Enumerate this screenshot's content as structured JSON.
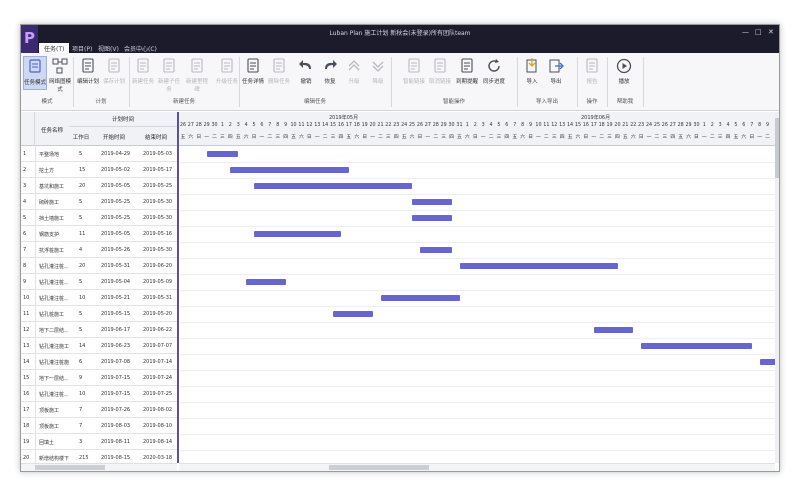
{
  "app": {
    "title": "Luban Plan 施工计划 新秋会(未登录)所有团队team",
    "logo": "P",
    "win_min": "—",
    "win_max": "□",
    "win_close": "✕"
  },
  "menu": [
    "任务(T)",
    "项目(P)",
    "视图(V)",
    "会员中心(C)"
  ],
  "ribbon": {
    "buttons": [
      {
        "label": "任务模式",
        "icon": "task-mode"
      },
      {
        "label": "网络图模式",
        "icon": "network"
      },
      {
        "label": "编辑计划",
        "icon": "edit-plan"
      },
      {
        "label": "保存计划",
        "icon": "save-plan"
      },
      {
        "label": "新建任务",
        "icon": "new-task"
      },
      {
        "label": "新建子任务",
        "icon": "new-sub"
      },
      {
        "label": "新建里程碑",
        "icon": "milestone"
      },
      {
        "label": "升级任务",
        "icon": "upgrade"
      },
      {
        "label": "任务详情",
        "icon": "details"
      },
      {
        "label": "删除任务",
        "icon": "delete"
      },
      {
        "label": "撤销",
        "icon": "undo"
      },
      {
        "label": "恢复",
        "icon": "redo"
      },
      {
        "label": "升级",
        "icon": "up"
      },
      {
        "label": "降级",
        "icon": "down"
      },
      {
        "label": "智能链接",
        "icon": "link"
      },
      {
        "label": "取消链接",
        "icon": "unlink"
      },
      {
        "label": "到期提醒",
        "icon": "reminder"
      },
      {
        "label": "同步进度",
        "icon": "sync"
      },
      {
        "label": "导入",
        "icon": "import"
      },
      {
        "label": "导出",
        "icon": "export"
      },
      {
        "label": "报告",
        "icon": "report"
      },
      {
        "label": "播放",
        "icon": "play"
      }
    ],
    "groups": [
      "模式",
      "计划",
      "新建任务",
      "编辑任务",
      "智能操作",
      "导入导出",
      "操作",
      "帮助我"
    ]
  },
  "grid": {
    "head_plan": "计划时间",
    "head_name": "任务名称",
    "head_duration": "工作日",
    "head_start": "开始时间",
    "head_end": "结束时间",
    "rows": [
      {
        "id": "1",
        "name": "平整场地",
        "dur": "5",
        "start": "2019-04-29",
        "end": "2019-05-03"
      },
      {
        "id": "2",
        "name": "挖土方",
        "dur": "15",
        "start": "2019-05-02",
        "end": "2019-05-17"
      },
      {
        "id": "3",
        "name": "基坑和施工",
        "dur": "20",
        "start": "2019-05-05",
        "end": "2019-05-25"
      },
      {
        "id": "4",
        "name": "砌砖施工",
        "dur": "5",
        "start": "2019-05-25",
        "end": "2019-05-30"
      },
      {
        "id": "5",
        "name": "挡土墙施工",
        "dur": "5",
        "start": "2019-05-25",
        "end": "2019-05-30"
      },
      {
        "id": "6",
        "name": "钢筋支护",
        "dur": "11",
        "start": "2019-05-05",
        "end": "2019-05-16"
      },
      {
        "id": "7",
        "name": "抗浮桩施工",
        "dur": "4",
        "start": "2019-05-26",
        "end": "2019-05-30"
      },
      {
        "id": "8",
        "name": "钻孔灌注桩...",
        "dur": "20",
        "start": "2019-05-31",
        "end": "2019-06-20"
      },
      {
        "id": "9",
        "name": "钻孔灌注桩...",
        "dur": "5",
        "start": "2019-05-04",
        "end": "2019-05-09"
      },
      {
        "id": "10",
        "name": "钻孔灌注桩...",
        "dur": "10",
        "start": "2019-05-21",
        "end": "2019-05-31"
      },
      {
        "id": "11",
        "name": "钻孔桩施工",
        "dur": "5",
        "start": "2019-05-15",
        "end": "2019-05-20"
      },
      {
        "id": "12",
        "name": "地下二层结...",
        "dur": "5",
        "start": "2019-06-17",
        "end": "2019-06-22"
      },
      {
        "id": "13",
        "name": "钻孔灌注施工",
        "dur": "14",
        "start": "2019-06-23",
        "end": "2019-07-07"
      },
      {
        "id": "14",
        "name": "钻孔灌注桩施工",
        "dur": "6",
        "start": "2019-07-08",
        "end": "2019-07-14"
      },
      {
        "id": "15",
        "name": "地下一层结...",
        "dur": "9",
        "start": "2019-07-15",
        "end": "2019-07-24"
      },
      {
        "id": "16",
        "name": "钻孔灌注桩...",
        "dur": "10",
        "start": "2019-07-15",
        "end": "2019-07-25"
      },
      {
        "id": "17",
        "name": "顶板施工",
        "dur": "7",
        "start": "2019-07-26",
        "end": "2019-08-02"
      },
      {
        "id": "18",
        "name": "顶板施工",
        "dur": "7",
        "start": "2019-08-03",
        "end": "2019-08-10"
      },
      {
        "id": "19",
        "name": "回填土",
        "dur": "3",
        "start": "2019-08-11",
        "end": "2019-08-14"
      },
      {
        "id": "20",
        "name": "新增结构楼下",
        "dur": "215",
        "start": "2019-08-15",
        "end": "2020-03-18"
      }
    ]
  },
  "chart": {
    "month_may": "2019年05月",
    "month_jun": "2019年06月",
    "day_numbers": [
      "26",
      "27",
      "28",
      "29",
      "30",
      "1",
      "2",
      "3",
      "4",
      "5",
      "6",
      "7",
      "8",
      "9",
      "10",
      "11",
      "12",
      "13",
      "14",
      "15",
      "16",
      "17",
      "18",
      "19",
      "20",
      "21",
      "22",
      "23",
      "24",
      "25",
      "26",
      "27",
      "28",
      "29",
      "30",
      "31",
      "1",
      "2",
      "3",
      "4",
      "5",
      "6",
      "7",
      "8",
      "9",
      "10",
      "11",
      "12",
      "13",
      "14",
      "15",
      "16",
      "17",
      "18",
      "19",
      "20",
      "21",
      "22",
      "23",
      "24",
      "25",
      "26",
      "27",
      "28",
      "29",
      "30",
      "1",
      "2",
      "3",
      "4",
      "5",
      "6",
      "7",
      "8",
      "9"
    ],
    "weekdays": [
      "五",
      "六",
      "日",
      "一",
      "二",
      "三",
      "四"
    ],
    "start_weekday_index": 0,
    "first_date": "2019-04-26",
    "accent": "#6766d0"
  }
}
